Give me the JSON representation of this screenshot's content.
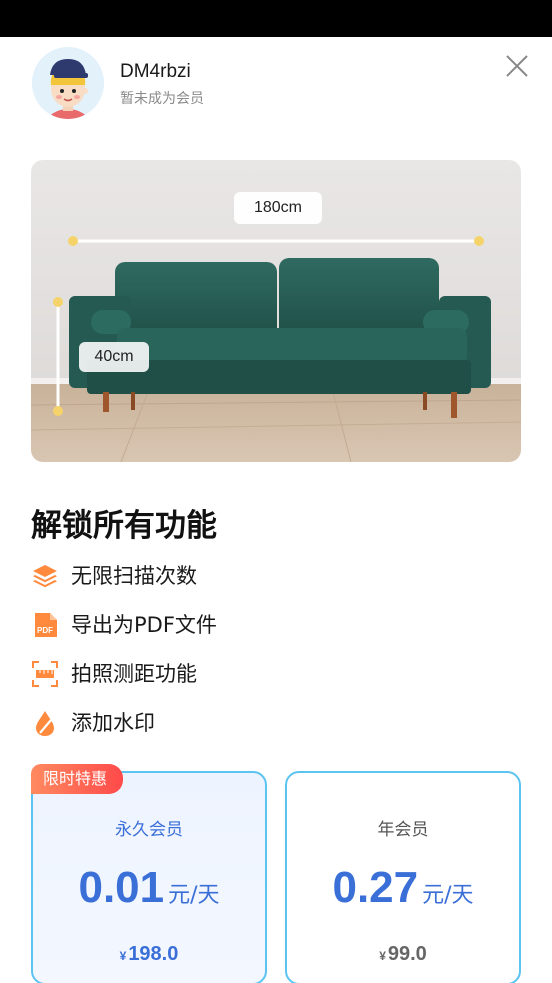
{
  "user": {
    "name": "DM4rbzi",
    "status": "暂未成为会员"
  },
  "hero": {
    "width_label": "180cm",
    "height_label": "40cm"
  },
  "features": {
    "title": "解锁所有功能",
    "items": [
      {
        "label": "无限扫描次数",
        "icon": "layers-icon",
        "color": "#ff8a3d"
      },
      {
        "label": "导出为PDF文件",
        "icon": "pdf-file-icon",
        "color": "#ff8a3d",
        "icon_text": "PDF"
      },
      {
        "label": "拍照测距功能",
        "icon": "ruler-scan-icon",
        "color": "#ff8a3d"
      },
      {
        "label": "添加水印",
        "icon": "watermark-drop-icon",
        "color": "#ff8a3d"
      }
    ]
  },
  "plans": {
    "badge": "限时特惠",
    "lifetime": {
      "name": "永久会员",
      "price": "0.01",
      "unit": "元/天",
      "currency": "¥",
      "total": "198.0"
    },
    "yearly": {
      "name": "年会员",
      "price": "0.27",
      "unit": "元/天",
      "currency": "¥",
      "total": "99.0"
    }
  },
  "colors": {
    "accent_blue": "#3a6fd8",
    "card_border": "#5cc4f0",
    "feature_orange": "#ff8a3d",
    "badge_red": "#ff4a4a"
  }
}
